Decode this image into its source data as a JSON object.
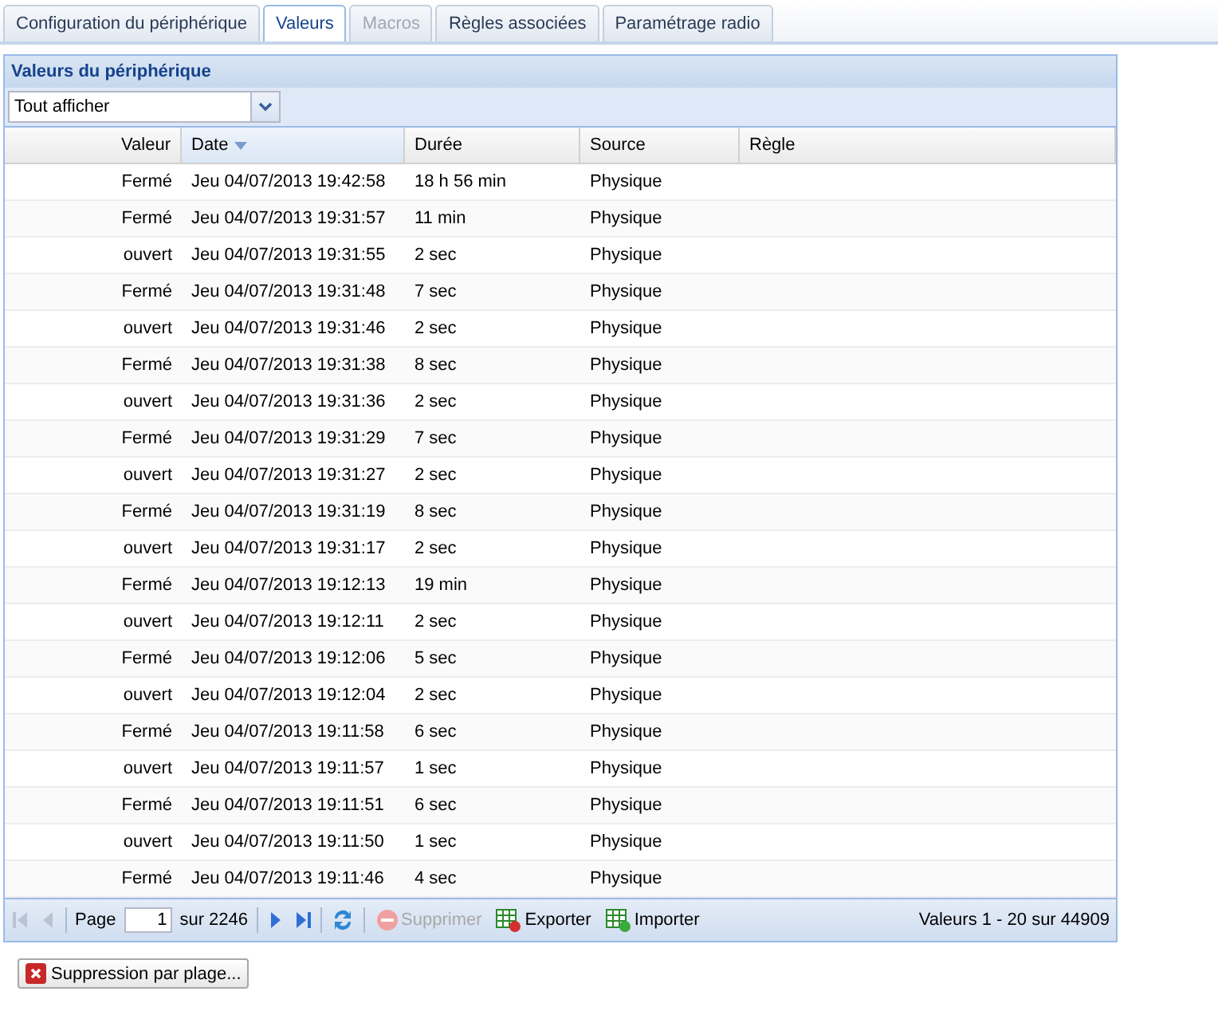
{
  "tabs": [
    {
      "label": "Configuration du périphérique",
      "selected": false,
      "disabled": false
    },
    {
      "label": "Valeurs",
      "selected": true,
      "disabled": false
    },
    {
      "label": "Macros",
      "selected": false,
      "disabled": true
    },
    {
      "label": "Règles associées",
      "selected": false,
      "disabled": false
    },
    {
      "label": "Paramétrage radio",
      "selected": false,
      "disabled": false
    }
  ],
  "panel": {
    "title": "Valeurs du périphérique",
    "filter": {
      "value": "Tout afficher"
    },
    "table": {
      "columns": [
        {
          "label": "Valeur",
          "sorted": false
        },
        {
          "label": "Date",
          "sorted": true
        },
        {
          "label": "Durée",
          "sorted": false
        },
        {
          "label": "Source",
          "sorted": false
        },
        {
          "label": "Règle",
          "sorted": false
        }
      ],
      "rows": [
        [
          "Fermé",
          "Jeu 04/07/2013 19:42:58",
          "18 h 56 min",
          "Physique"
        ],
        [
          "Fermé",
          "Jeu 04/07/2013 19:31:57",
          "11 min",
          "Physique"
        ],
        [
          "ouvert",
          "Jeu 04/07/2013 19:31:55",
          "2 sec",
          "Physique"
        ],
        [
          "Fermé",
          "Jeu 04/07/2013 19:31:48",
          "7 sec",
          "Physique"
        ],
        [
          "ouvert",
          "Jeu 04/07/2013 19:31:46",
          "2 sec",
          "Physique"
        ],
        [
          "Fermé",
          "Jeu 04/07/2013 19:31:38",
          "8 sec",
          "Physique"
        ],
        [
          "ouvert",
          "Jeu 04/07/2013 19:31:36",
          "2 sec",
          "Physique"
        ],
        [
          "Fermé",
          "Jeu 04/07/2013 19:31:29",
          "7 sec",
          "Physique"
        ],
        [
          "ouvert",
          "Jeu 04/07/2013 19:31:27",
          "2 sec",
          "Physique"
        ],
        [
          "Fermé",
          "Jeu 04/07/2013 19:31:19",
          "8 sec",
          "Physique"
        ],
        [
          "ouvert",
          "Jeu 04/07/2013 19:31:17",
          "2 sec",
          "Physique"
        ],
        [
          "Fermé",
          "Jeu 04/07/2013 19:12:13",
          "19 min",
          "Physique"
        ],
        [
          "ouvert",
          "Jeu 04/07/2013 19:12:11",
          "2 sec",
          "Physique"
        ],
        [
          "Fermé",
          "Jeu 04/07/2013 19:12:06",
          "5 sec",
          "Physique"
        ],
        [
          "ouvert",
          "Jeu 04/07/2013 19:12:04",
          "2 sec",
          "Physique"
        ],
        [
          "Fermé",
          "Jeu 04/07/2013 19:11:58",
          "6 sec",
          "Physique"
        ],
        [
          "ouvert",
          "Jeu 04/07/2013 19:11:57",
          "1 sec",
          "Physique"
        ],
        [
          "Fermé",
          "Jeu 04/07/2013 19:11:51",
          "6 sec",
          "Physique"
        ],
        [
          "ouvert",
          "Jeu 04/07/2013 19:11:50",
          "1 sec",
          "Physique"
        ],
        [
          "Fermé",
          "Jeu 04/07/2013 19:11:46",
          "4 sec",
          "Physique"
        ]
      ]
    },
    "pager": {
      "page_label": "Page",
      "page": "1",
      "of": "sur 2246",
      "delete": {
        "label": "Supprimer",
        "disabled": true
      },
      "export": "Exporter",
      "import": "Importer",
      "summary": "Valeurs 1 - 20 sur 44909"
    }
  },
  "range_delete_button": "Suppression par plage..."
}
